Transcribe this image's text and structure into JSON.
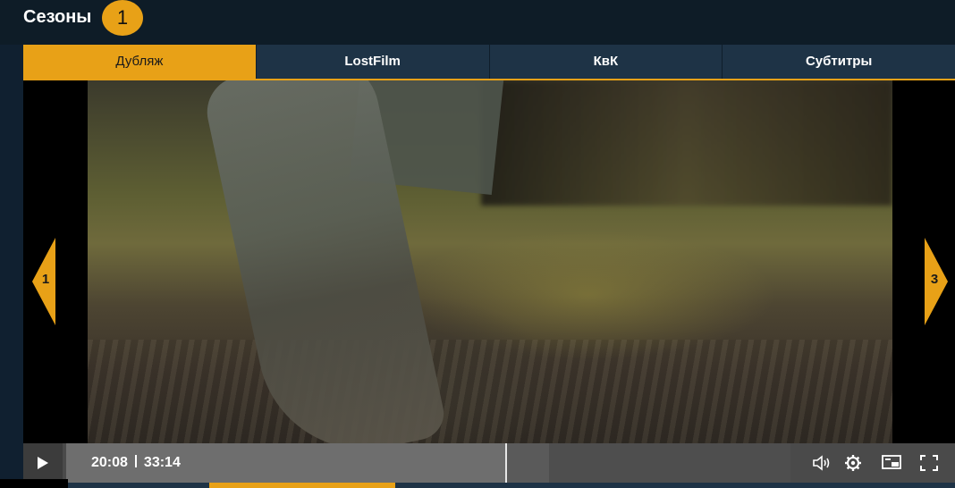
{
  "header": {
    "title": "Сезоны",
    "season_number": "1"
  },
  "tabs": [
    {
      "label": "Дубляж",
      "active": true
    },
    {
      "label": "LostFilm",
      "active": false
    },
    {
      "label": "КвК",
      "active": false
    },
    {
      "label": "Субтитры",
      "active": false
    }
  ],
  "player": {
    "prev_episode": "1",
    "next_episode": "3",
    "current_time": "20:08",
    "duration": "33:14",
    "progress_fraction": 0.606,
    "buffered_fraction": 0.666,
    "icons": {
      "play": "play-icon",
      "volume": "volume-icon",
      "settings": "gear-icon",
      "pip": "picture-in-picture-icon",
      "fullscreen": "fullscreen-icon"
    }
  },
  "colors": {
    "accent": "#e8a117",
    "background": "#102030",
    "tab_bar": "#1e3346"
  }
}
